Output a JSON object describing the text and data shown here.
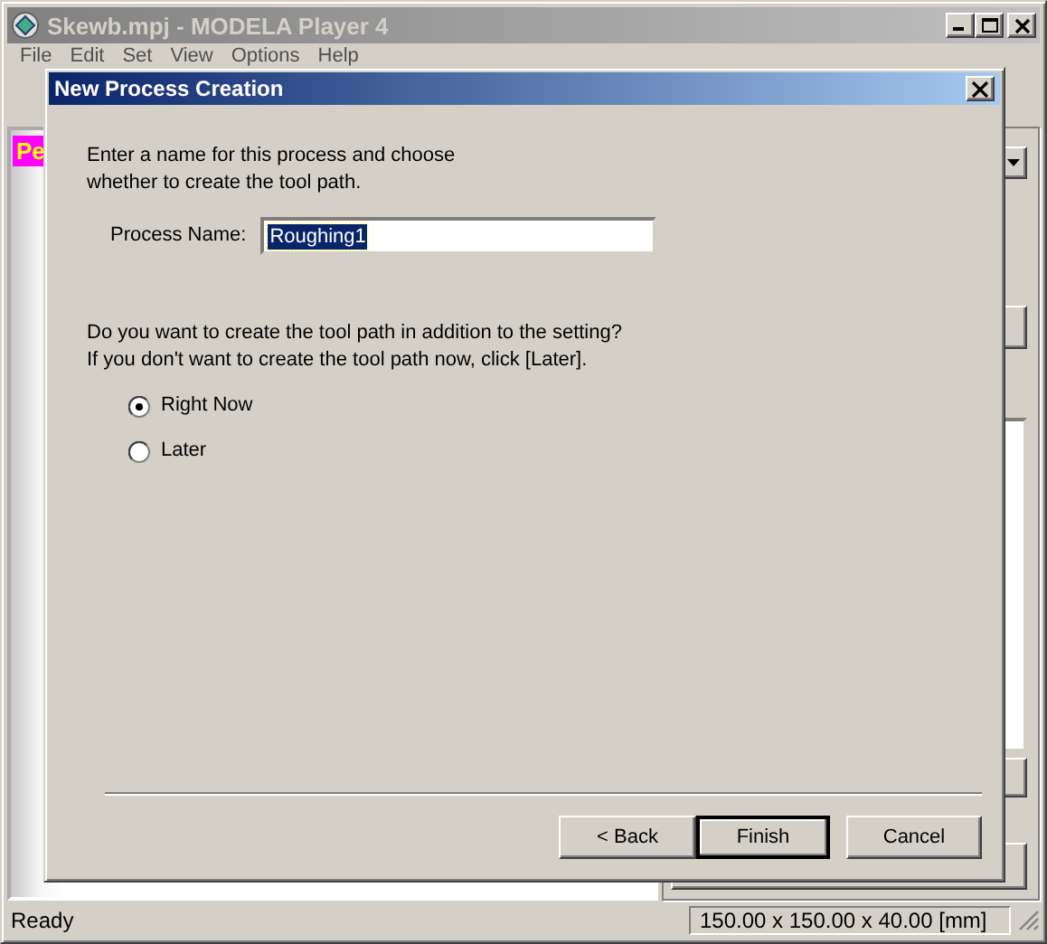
{
  "main_window": {
    "title": "Skewb.mpj - MODELA Player 4",
    "active": false,
    "menu": [
      "File",
      "Edit",
      "Set",
      "View",
      "Options",
      "Help"
    ],
    "canvas_label": "Pe"
  },
  "dialog": {
    "title": "New Process Creation",
    "active": true,
    "intro_lines": [
      "Enter a name for this process and choose",
      "whether to create the tool path."
    ],
    "process_name": {
      "label": "Process Name:",
      "value": "Roughing1",
      "selected": true
    },
    "question_lines": [
      "Do you want to create the tool path in addition to the setting?",
      "If you don't want to create the tool path now, click [Later]."
    ],
    "options": [
      {
        "label": "Right Now",
        "selected": true
      },
      {
        "label": "Later",
        "selected": false
      }
    ],
    "buttons": [
      {
        "label": "< Back",
        "default": false
      },
      {
        "label": "Finish",
        "default": true
      },
      {
        "label": "Cancel",
        "default": false
      }
    ]
  },
  "status_bar": {
    "message": "Ready",
    "dimensions": "150.00 x 150.00 x 40.00 [mm]"
  }
}
